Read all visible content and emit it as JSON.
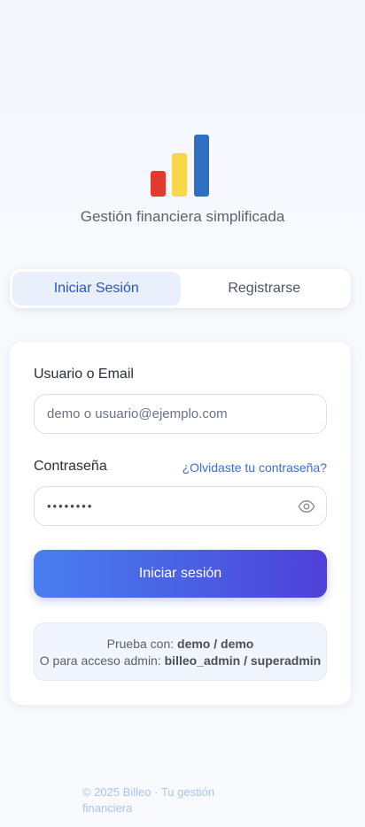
{
  "logo": {
    "name": "bar-chart-logo",
    "colors": [
      "#e23a2e",
      "#f7d84b",
      "#2f6fc0"
    ]
  },
  "tagline": "Gestión financiera simplificada",
  "tabs": [
    {
      "label": "Iniciar Sesión",
      "active": true
    },
    {
      "label": "Registrarse",
      "active": false
    }
  ],
  "form": {
    "user_label": "Usuario o Email",
    "user_placeholder": "demo o usuario@ejemplo.com",
    "password_label": "Contraseña",
    "forgot_link": "¿Olvidaste tu contraseña?",
    "password_value": "••••••••",
    "eye_icon": "eye-icon",
    "submit_label": "Iniciar sesión"
  },
  "hint": {
    "line1_prefix": "Prueba con: ",
    "line1_creds": "demo / demo",
    "line2_prefix": "O para acceso admin: ",
    "line2_creds": "billeo_admin / superadmin"
  },
  "footer": "© 2025 Billeo · Tu gestión financiera",
  "colors": {
    "accent": "#2a55c8",
    "link": "#3a6fd6",
    "button_start": "#4a7ef0",
    "button_end": "#4f3fd9"
  }
}
